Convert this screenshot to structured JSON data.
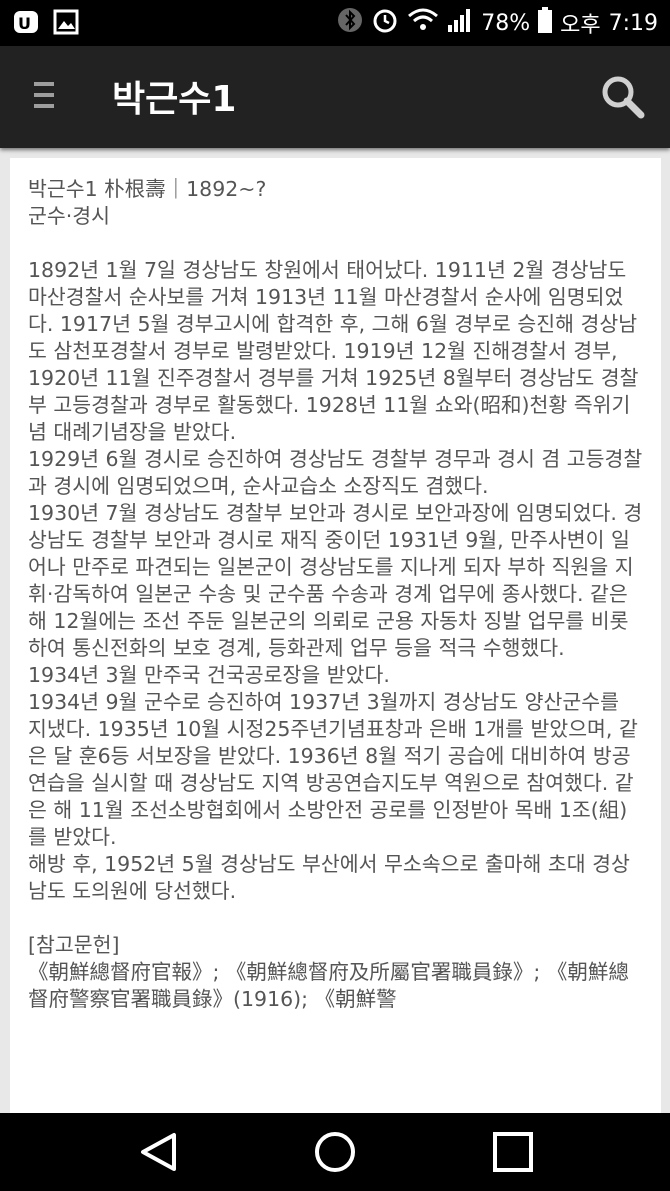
{
  "status_bar": {
    "battery": "78%",
    "ampm": "오후",
    "time": "7:19",
    "icons": [
      "u-plus-icon",
      "gallery-icon",
      "bluetooth-icon",
      "alarm-icon",
      "wifi-icon",
      "signal-icon",
      "battery-icon"
    ]
  },
  "app_bar": {
    "title": "박근수1",
    "menu_icon": "hamburger-menu-icon",
    "search_icon": "search-icon"
  },
  "article": {
    "heading": "박근수1 朴根壽｜1892~?",
    "subheading": "군수·경시",
    "paragraphs": [
      "1892년 1월 7일 경상남도 창원에서 태어났다. 1911년 2월 경상남도 마산경찰서 순사보를 거쳐 1913년 11월 마산경찰서 순사에 임명되었다. 1917년 5월 경부고시에 합격한 후, 그해 6월 경부로 승진해 경상남도 삼천포경찰서 경부로 발령받았다. 1919년 12월 진해경찰서 경부, 1920년 11월 진주경찰서 경부를 거쳐 1925년 8월부터 경상남도 경찰부 고등경찰과 경부로 활동했다. 1928년 11월 쇼와(昭和)천황 즉위기념 대례기념장을 받았다.",
      "1929년 6월 경시로 승진하여 경상남도 경찰부 경무과 경시 겸 고등경찰과 경시에 임명되었으며, 순사교습소 소장직도 겸했다.",
      "1930년 7월 경상남도 경찰부 보안과 경시로 보안과장에 임명되었다. 경상남도 경찰부 보안과 경시로 재직 중이던 1931년 9월, 만주사변이 일어나 만주로 파견되는 일본군이 경상남도를 지나게 되자 부하 직원을 지휘·감독하여 일본군 수송 및 군수품 수송과 경계 업무에 종사했다. 같은 해 12월에는 조선 주둔 일본군의 의뢰로 군용 자동차 징발 업무를 비롯하여 통신전화의 보호 경계, 등화관제 업무 등을 적극 수행했다.",
      "1934년 3월 만주국 건국공로장을 받았다.",
      "1934년 9월 군수로 승진하여 1937년 3월까지 경상남도 양산군수를 지냈다. 1935년 10월 시정25주년기념표창과 은배 1개를 받았으며, 같은 달 훈6등 서보장을 받았다. 1936년 8월 적기 공습에 대비하여 방공연습을 실시할 때 경상남도 지역 방공연습지도부 역원으로 참여했다. 같은 해 11월 조선소방협회에서 소방안전 공로를 인정받아 목배 1조(組)를 받았다.",
      "해방 후, 1952년 5월 경상남도 부산에서 무소속으로 출마해 초대 경상남도 도의원에 당선했다."
    ],
    "references_label": "[참고문헌]",
    "references_text": "《朝鮮總督府官報》; 《朝鮮總督府及所屬官署職員錄》; 《朝鮮總督府警察官署職員錄》(1916); 《朝鮮警"
  },
  "nav_bar": {
    "icons": [
      "back-triangle-icon",
      "home-circle-icon",
      "recents-square-icon"
    ]
  }
}
